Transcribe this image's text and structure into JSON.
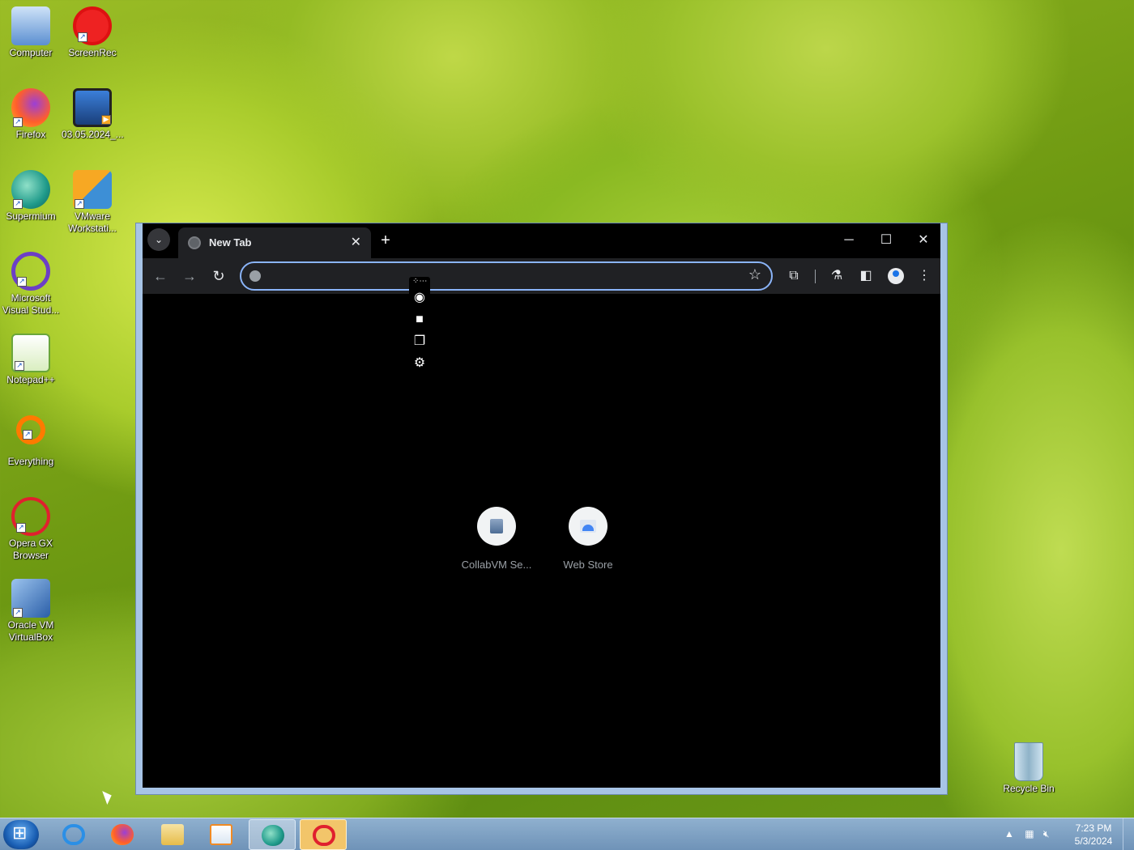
{
  "desktop": {
    "icons": [
      {
        "label": "Computer",
        "icon": "computer-icon"
      },
      {
        "label": "ScreenRec",
        "icon": "screenrec-icon"
      },
      {
        "label": "Firefox",
        "icon": "firefox-icon"
      },
      {
        "label": "03.05.2024_...",
        "icon": "video-file-icon"
      },
      {
        "label": "Supermium",
        "icon": "supermium-icon"
      },
      {
        "label": "VMware Workstati...",
        "icon": "vmware-icon"
      },
      {
        "label": "Microsoft Visual Stud...",
        "icon": "visual-studio-icon"
      },
      {
        "label": "Notepad++",
        "icon": "notepad-plus-plus-icon"
      },
      {
        "label": "Everything",
        "icon": "everything-icon"
      },
      {
        "label": "Opera GX Browser",
        "icon": "opera-gx-icon"
      },
      {
        "label": "Oracle VM VirtualBox",
        "icon": "virtualbox-icon"
      },
      {
        "label": "Recycle Bin",
        "icon": "recycle-bin-icon"
      }
    ]
  },
  "browser": {
    "tab_title": "New Tab",
    "new_tab_glyph": "+",
    "omnibox_value": "",
    "shortcuts": [
      {
        "label": "CollabVM Se...",
        "icon": "collabvm-icon"
      },
      {
        "label": "Web Store",
        "icon": "web-store-icon"
      }
    ]
  },
  "capture_toolbar": {
    "items": [
      "camera-icon",
      "video-camera-icon",
      "window-capture-icon",
      "gear-icon"
    ]
  },
  "taskbar": {
    "apps": [
      "internet-explorer-icon",
      "firefox-icon",
      "file-explorer-icon",
      "media-player-icon",
      "supermium-icon",
      "opera-gx-icon"
    ],
    "time": "7:23 PM",
    "date": "5/3/2024"
  },
  "colors": {
    "accent": "#8ab4f8",
    "browser_frame": "#a7c4e6",
    "taskbar": "#7a9cc0"
  }
}
